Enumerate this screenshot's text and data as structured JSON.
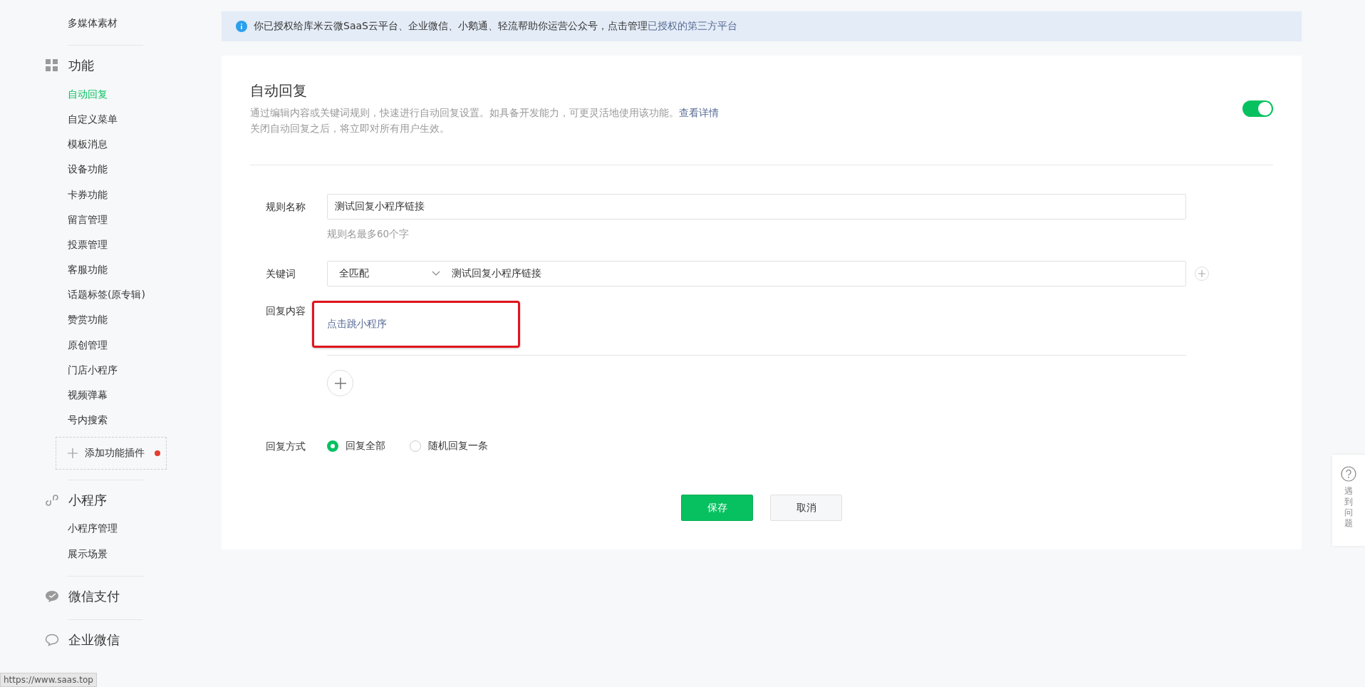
{
  "sidebar": {
    "groups": [
      {
        "items": [
          {
            "label": "多媒体素材",
            "selected": false
          }
        ]
      },
      {
        "title": "功能",
        "items": [
          {
            "label": "自动回复",
            "selected": true
          },
          {
            "label": "自定义菜单",
            "selected": false
          },
          {
            "label": "模板消息",
            "selected": false
          },
          {
            "label": "设备功能",
            "selected": false
          },
          {
            "label": "卡券功能",
            "selected": false
          },
          {
            "label": "留言管理",
            "selected": false
          },
          {
            "label": "投票管理",
            "selected": false
          },
          {
            "label": "客服功能",
            "selected": false
          },
          {
            "label": "话题标签(原专辑)",
            "selected": false
          },
          {
            "label": "赞赏功能",
            "selected": false
          },
          {
            "label": "原创管理",
            "selected": false
          },
          {
            "label": "门店小程序",
            "selected": false
          },
          {
            "label": "视频弹幕",
            "selected": false
          },
          {
            "label": "号内搜索",
            "selected": false
          }
        ],
        "add_plugin": {
          "label": "添加功能插件",
          "new_dot": true
        }
      },
      {
        "title": "小程序",
        "items": [
          {
            "label": "小程序管理",
            "selected": false
          },
          {
            "label": "展示场景",
            "selected": false
          }
        ]
      },
      {
        "title": "微信支付"
      },
      {
        "title": "企业微信"
      }
    ]
  },
  "notice": {
    "text": "你已授权给库米云微SaaS云平台、企业微信、小鹅通、轻流帮助你运营公众号，点击管理",
    "link": "已授权的第三方平台"
  },
  "card": {
    "title": "自动回复",
    "description": "通过编辑内容或关键词规则，快速进行自动回复设置。如具备开发能力，可更灵活地使用该功能。",
    "details_link": "查看详情",
    "note": "关闭自动回复之后，将立即对所有用户生效。",
    "toggle": {
      "on": true
    }
  },
  "form": {
    "rule_name": {
      "label": "规则名称",
      "value": "测试回复小程序链接",
      "hint": "规则名最多60个字"
    },
    "keyword": {
      "label": "关键词",
      "match": "全匹配",
      "value": "测试回复小程序链接"
    },
    "reply_content": {
      "label": "回复内容",
      "items": [
        {
          "text": "点击跳小程序",
          "highlighted": true
        }
      ]
    },
    "reply_mode": {
      "label": "回复方式",
      "options": [
        {
          "label": "回复全部",
          "selected": true
        },
        {
          "label": "随机回复一条",
          "selected": false
        }
      ]
    },
    "buttons": {
      "save": "保存",
      "cancel": "取消"
    }
  },
  "help": {
    "label": "遇到问题"
  },
  "status_url": "https://www.saas.top"
}
